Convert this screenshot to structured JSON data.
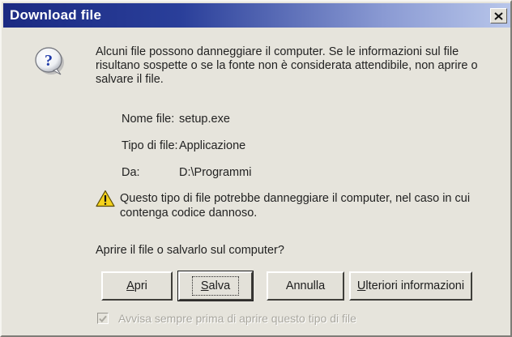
{
  "dialog": {
    "title": "Download file",
    "close_symbol": "×",
    "message": "Alcuni file possono danneggiare il computer. Se le informazioni sul file risultano sospette o se la fonte non è considerata attendibile, non aprire o salvare il file.",
    "info": {
      "name_label": "Nome file:",
      "name_value": "setup.exe",
      "type_label": "Tipo di file:",
      "type_value": "Applicazione",
      "from_label": "Da:",
      "from_value": "D:\\Programmi"
    },
    "warning": "Questo tipo di file potrebbe danneggiare il computer, nel caso in cui contenga codice dannoso.",
    "prompt": "Aprire il file o salvarlo sul computer?",
    "buttons": {
      "open": "Apri",
      "save": "Salva",
      "cancel": "Annulla",
      "more_info": "Ulteriori informazioni"
    },
    "checkbox": {
      "label": "Avvisa sempre prima di aprire questo tipo di file",
      "checked": true,
      "disabled": true
    },
    "icons": {
      "main": "question-icon",
      "warning": "warning-icon",
      "close": "close-icon"
    },
    "colors": {
      "title_bar_start": "#1b2a82",
      "title_bar_end": "#b8c6ea",
      "face": "#e6e4dc"
    }
  }
}
